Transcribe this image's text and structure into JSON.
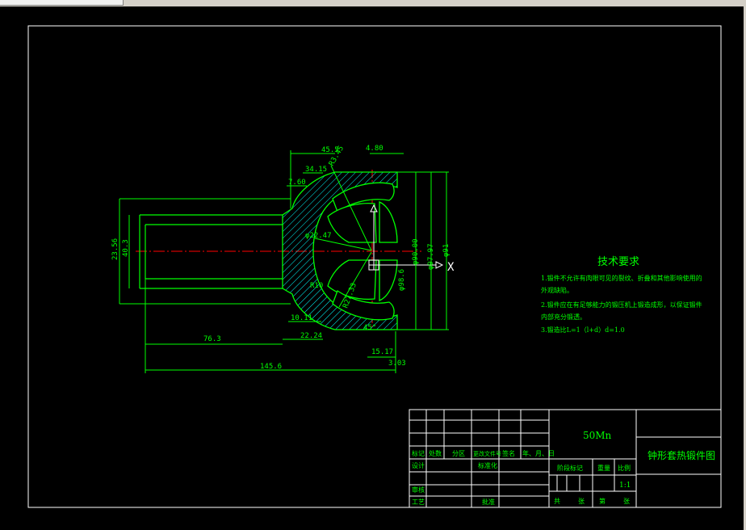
{
  "colors": {
    "background": "#000000",
    "frame": "#ffffff",
    "outline": "#00ff00",
    "dimension": "#00ff00",
    "centerline": "#ff0000",
    "hatch": "#00ffff",
    "text": "#00ff00",
    "axis": "#ffffff"
  },
  "dimensions": {
    "d_45_5": "45.5",
    "d_4_80": "4.80",
    "d_34_15": "34.15",
    "d_7_60": "7.60",
    "d_r_top": "R3.45",
    "d_23_56": "23.56",
    "d_40_3": "40.3",
    "d_phi_22_47": "φ22.47",
    "d_r10": "R10",
    "d_10_11": "10.11",
    "d_22_24": "22.24",
    "d_76_3": "76.3",
    "d_145_6": "145.6",
    "d_15_17": "15.17",
    "d_3_03": "3.03",
    "d_phi_90": "φ90.00",
    "d_phi_97": "φ97.97",
    "d_phi_98": "φ98.6",
    "d_a1": "φ91",
    "d_r27": "R27.33",
    "d_angle": "45°",
    "axis_x": "X"
  },
  "tech_requirements": {
    "title": "技术要求",
    "items": [
      "1.锻件不允许有肉眼可见的裂纹、折叠和其他影响使用的",
      "外观缺陷。",
      "2.锻件应在有足够能力的锻压机上锻造成形，以保证锻件",
      "内部充分锻透。",
      "3.锻造比L=1（l+d）d=1.0"
    ]
  },
  "title_block": {
    "material": "50Mn",
    "drawing_name": "钟形套热锻件图",
    "rev_headers": [
      "标记",
      "处数",
      "分区",
      "更改文件号",
      "签名",
      "年、月、日"
    ],
    "design_label": "设计",
    "standard_label": "标准化",
    "stage_label": "阶段标记",
    "weight_label": "重量",
    "scale_label": "比例",
    "scale_value": "1:1",
    "review_label": "审核",
    "process_label": "工艺",
    "approve_label": "批准",
    "sheets_total": "共",
    "sheets_unit": "张",
    "sheet_no": "第",
    "sheet_unit2": "张"
  }
}
